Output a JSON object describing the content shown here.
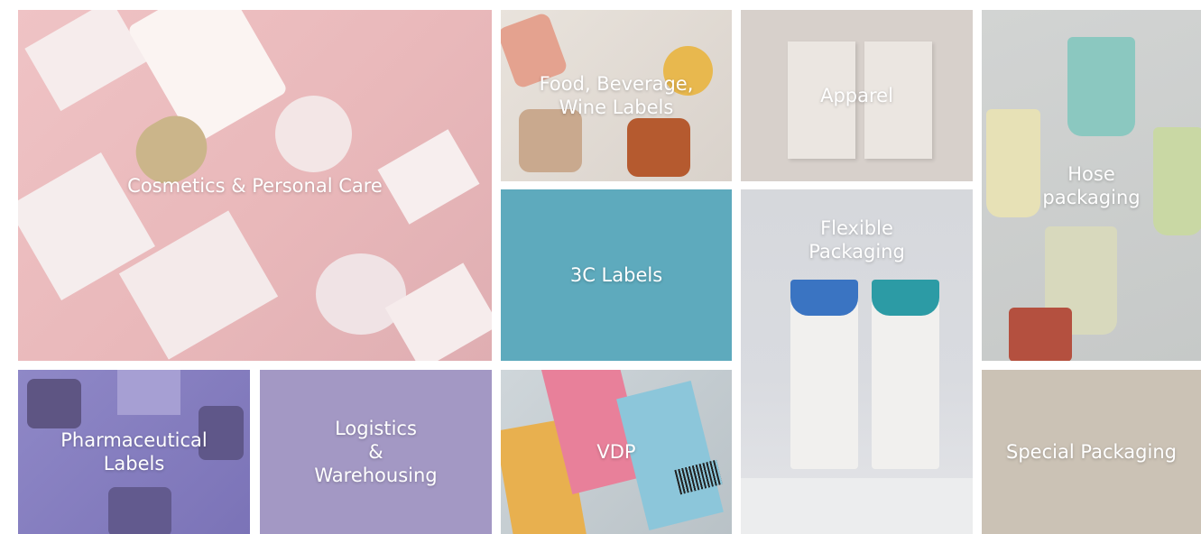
{
  "tiles": {
    "cosmetics": {
      "label": "Cosmetics & Personal Care"
    },
    "food": {
      "label": "Food, Beverage,\nWine Labels"
    },
    "apparel": {
      "label": "Apparel"
    },
    "hose": {
      "label": "Hose\npackaging"
    },
    "labels_3c": {
      "label": "3C Labels"
    },
    "flexible": {
      "label": "Flexible\nPackaging"
    },
    "pharma": {
      "label": "Pharmaceutical\nLabels"
    },
    "logistics": {
      "label": "Logistics\n&\nWarehousing"
    },
    "vdp": {
      "label": "VDP"
    },
    "special": {
      "label": "Special Packaging"
    }
  },
  "colors": {
    "labels_3c_bg": "#5eaabd",
    "logistics_bg": "#a398c4",
    "special_bg": "#cbc2b5",
    "cosmetics_bg": "#efc3c5",
    "pharma_bg": "#8f88c7"
  }
}
